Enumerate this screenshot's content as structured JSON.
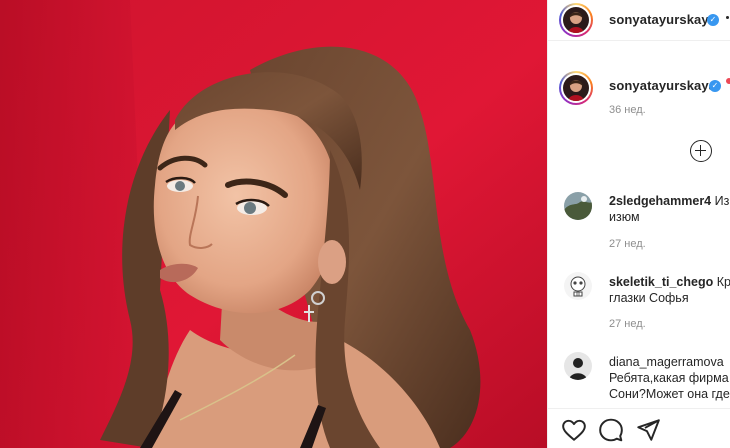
{
  "post": {
    "author": "sonyatayurskaya",
    "verified": true,
    "image_icon": "portrait-photo",
    "accent_red": "#c8102e"
  },
  "header": {
    "username": "sonyatayurskaya",
    "verified_icon": "verified-badge-icon",
    "follow_separator": "•"
  },
  "caption": {
    "username": "sonyatayurskaya",
    "age": "36 нед."
  },
  "load_more_icon": "plus-circle-icon",
  "comments": [
    {
      "username": "2sledgehammer4",
      "text_line1": "Из",
      "text_line2": "изюм",
      "age": "27 нед.",
      "avatar_icon": "landscape-avatar"
    },
    {
      "username": "skeletik_ti_chego",
      "text_line1": "Кра",
      "text_line2": "глазки Софья",
      "age": "27 нед.",
      "avatar_icon": "skull-avatar"
    },
    {
      "username": "diana_magerramova",
      "text_line1": "",
      "text_line2": "Ребята,какая фирма",
      "text_line3": "Сони?Может она где",
      "age": "",
      "avatar_icon": "person-avatar"
    }
  ],
  "action_icons": [
    "heart-icon",
    "comment-icon",
    "share-icon"
  ]
}
